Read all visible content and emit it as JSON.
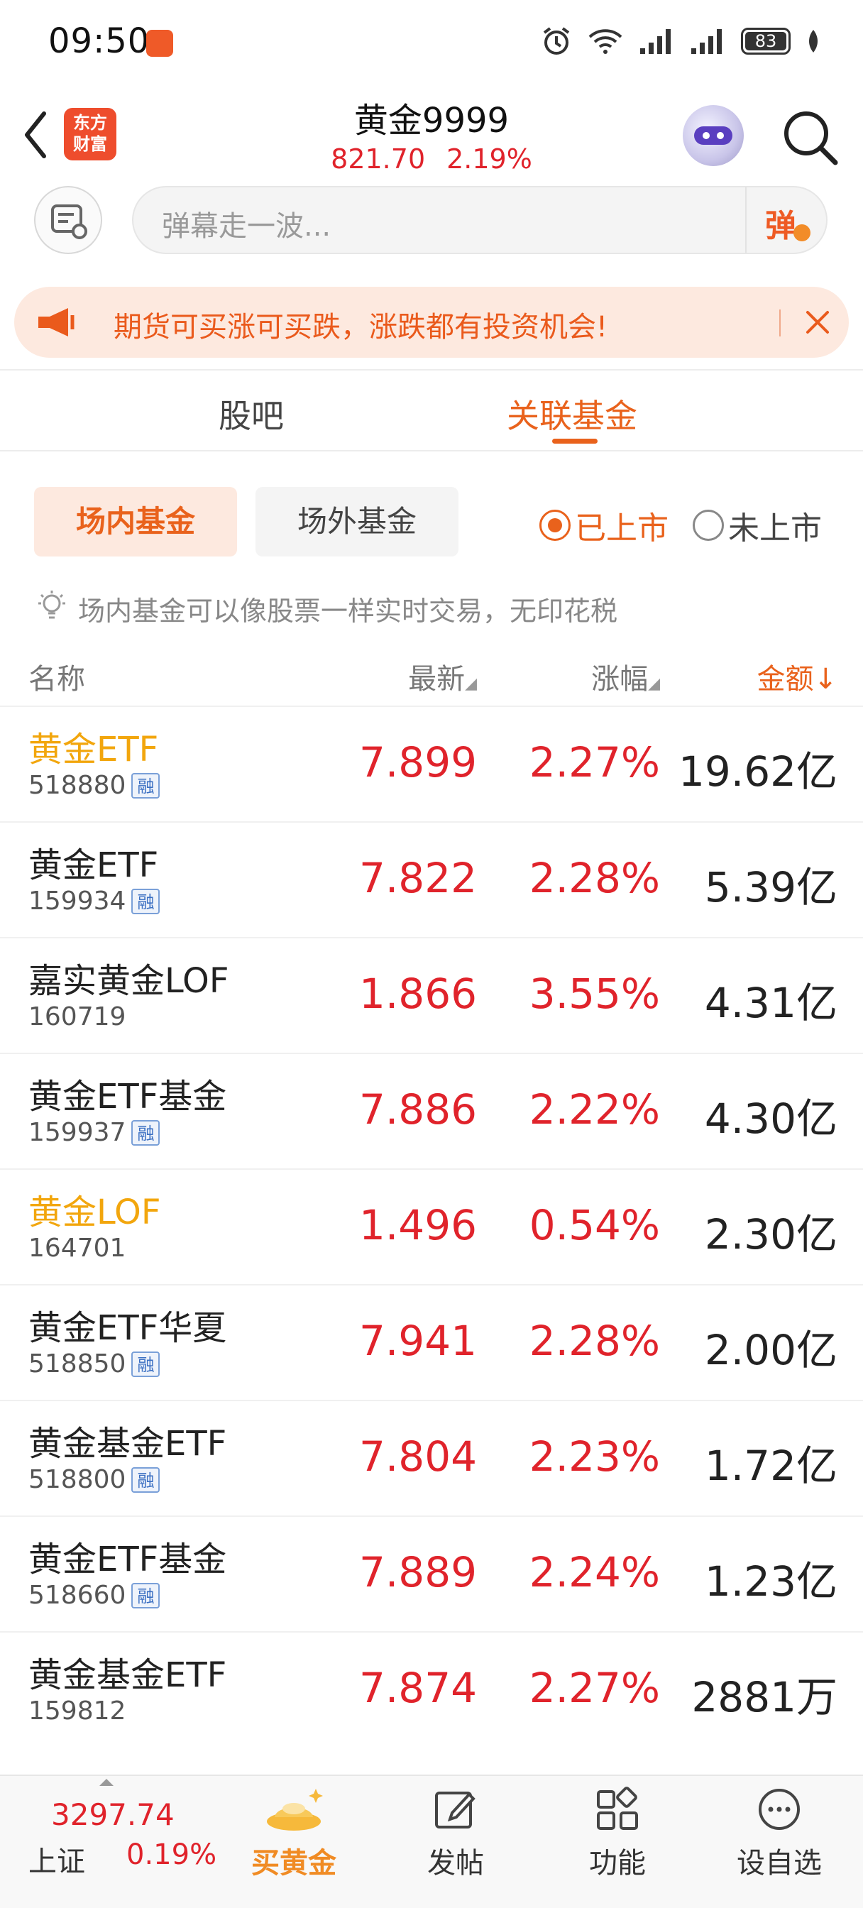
{
  "status_bar": {
    "time": "09:50",
    "battery": "83",
    "icons": [
      "app-notify-icon",
      "alarm-icon",
      "wifi-icon",
      "signal-icon",
      "signal-icon",
      "battery-icon",
      "leaf-icon"
    ]
  },
  "header": {
    "logo_line1": "东方",
    "logo_line2": "财富",
    "title": "黄金9999",
    "price": "821.70",
    "change": "2.19%"
  },
  "barrage": {
    "placeholder": "弹幕走一波...",
    "button": "弹"
  },
  "promo": {
    "text": "期货可买涨可买跌，涨跌都有投资机会!"
  },
  "tabs": {
    "guba": "股吧",
    "related_funds": "关联基金"
  },
  "subtabs": {
    "in_market": "场内基金",
    "off_market": "场外基金",
    "listed": "已上市",
    "unlisted": "未上市"
  },
  "tip": "场内基金可以像股票一样实时交易，无印花税",
  "table": {
    "headers": {
      "name": "名称",
      "latest": "最新",
      "change": "涨幅",
      "amount": "金额",
      "amount_arrow": "↓"
    },
    "rong_label": "融",
    "rows": [
      {
        "name": "黄金ETF",
        "code": "518880",
        "rong": true,
        "highlight": true,
        "price": "7.899",
        "change": "2.27%",
        "amount": "19.62亿"
      },
      {
        "name": "黄金ETF",
        "code": "159934",
        "rong": true,
        "highlight": false,
        "price": "7.822",
        "change": "2.28%",
        "amount": "5.39亿"
      },
      {
        "name": "嘉实黄金LOF",
        "code": "160719",
        "rong": false,
        "highlight": false,
        "price": "1.866",
        "change": "3.55%",
        "amount": "4.31亿"
      },
      {
        "name": "黄金ETF基金",
        "code": "159937",
        "rong": true,
        "highlight": false,
        "price": "7.886",
        "change": "2.22%",
        "amount": "4.30亿"
      },
      {
        "name": "黄金LOF",
        "code": "164701",
        "rong": false,
        "highlight": true,
        "price": "1.496",
        "change": "0.54%",
        "amount": "2.30亿"
      },
      {
        "name": "黄金ETF华夏",
        "code": "518850",
        "rong": true,
        "highlight": false,
        "price": "7.941",
        "change": "2.28%",
        "amount": "2.00亿"
      },
      {
        "name": "黄金基金ETF",
        "code": "518800",
        "rong": true,
        "highlight": false,
        "price": "7.804",
        "change": "2.23%",
        "amount": "1.72亿"
      },
      {
        "name": "黄金ETF基金",
        "code": "518660",
        "rong": true,
        "highlight": false,
        "price": "7.889",
        "change": "2.24%",
        "amount": "1.23亿"
      },
      {
        "name": "黄金基金ETF",
        "code": "159812",
        "rong": false,
        "highlight": false,
        "price": "7.874",
        "change": "2.27%",
        "amount": "2881万"
      }
    ]
  },
  "bottom_nav": {
    "index_value": "3297.74",
    "index_name": "上证",
    "index_change": "0.19%",
    "buy_gold": "买黄金",
    "post": "发帖",
    "functions": "功能",
    "watchlist": "设自选"
  },
  "colors": {
    "accent": "#e9621c",
    "up_red": "#e0232b",
    "gold_highlight": "#f2a60d"
  }
}
